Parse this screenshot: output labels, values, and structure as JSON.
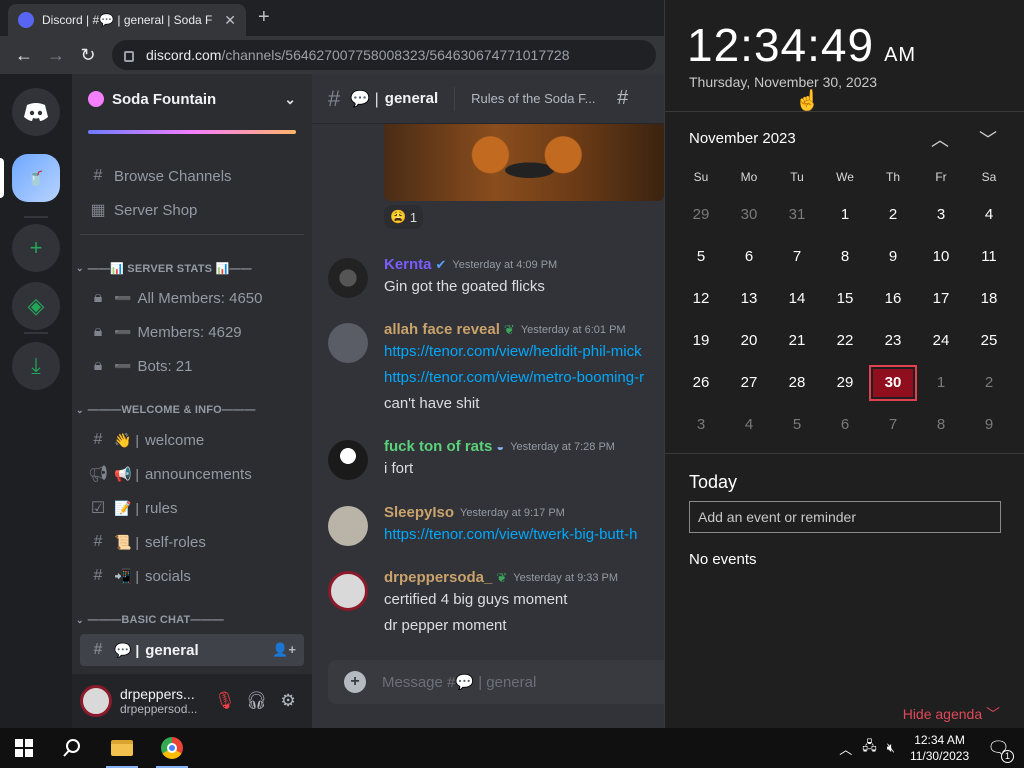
{
  "browser": {
    "tab_title": "Discord | #💬 | general | Soda F",
    "url_host": "discord.com",
    "url_path": "/channels/564627007758008323/564630674771017728"
  },
  "server": {
    "name": "Soda Fountain",
    "channels": {
      "browse": "Browse Channels",
      "shop": "Server Shop",
      "cat_stats": "——📊 SERVER STATS 📊——",
      "all_members": "All Members: 4650",
      "members": "Members: 4629",
      "bots": "Bots: 21",
      "cat_welcome": "———WELCOME & INFO———",
      "welcome": "welcome",
      "announcements": "announcements",
      "rules": "rules",
      "self_roles": "self-roles",
      "socials": "socials",
      "cat_basic": "———BASIC CHAT———",
      "general": "general"
    }
  },
  "user": {
    "display": "drpeppers...",
    "handle": "drpeppersod..."
  },
  "chat": {
    "channel": "general",
    "topic": "Rules of the Soda F...",
    "reaction_count": "1",
    "messages": [
      {
        "user": "Kernta",
        "user_color": "#7b5cff",
        "time": "Yesterday at 4:09 PM",
        "lines": [
          "Gin got the goated flicks"
        ]
      },
      {
        "user": "allah face reveal",
        "user_color": "#c9a36b",
        "time": "Yesterday at 6:01 PM",
        "lines": [
          "https://tenor.com/view/hedidit-phil-mick",
          "https://tenor.com/view/metro-booming-r",
          "can't have shit"
        ]
      },
      {
        "user": "fuck ton of rats",
        "user_color": "#5bd17a",
        "time": "Yesterday at 7:28 PM",
        "lines": [
          "i fort"
        ]
      },
      {
        "user": "SleepyIso",
        "user_color": "#c9a36b",
        "time": "Yesterday at 9:17 PM",
        "lines": [
          "https://tenor.com/view/twerk-big-butt-h"
        ]
      },
      {
        "user": "drpeppersoda_",
        "user_color": "#c9a36b",
        "time": "Yesterday at 9:33 PM",
        "lines": [
          "certified 4 big guys moment",
          "dr pepper moment"
        ]
      }
    ],
    "composer_placeholder": "Message #💬 | general"
  },
  "calendar": {
    "time": "12:34:49",
    "ampm": "AM",
    "date": "Thursday, November 30, 2023",
    "month": "November 2023",
    "dow": [
      "Su",
      "Mo",
      "Tu",
      "We",
      "Th",
      "Fr",
      "Sa"
    ],
    "days": [
      [
        "29",
        "30",
        "31",
        "1",
        "2",
        "3",
        "4"
      ],
      [
        "5",
        "6",
        "7",
        "8",
        "9",
        "10",
        "11"
      ],
      [
        "12",
        "13",
        "14",
        "15",
        "16",
        "17",
        "18"
      ],
      [
        "19",
        "20",
        "21",
        "22",
        "23",
        "24",
        "25"
      ],
      [
        "26",
        "27",
        "28",
        "29",
        "30",
        "1",
        "2"
      ],
      [
        "3",
        "4",
        "5",
        "6",
        "7",
        "8",
        "9"
      ]
    ],
    "today_label": "Today",
    "event_placeholder": "Add an event or reminder",
    "no_events": "No events",
    "hide_agenda": "Hide agenda ﹀"
  },
  "taskbar": {
    "time": "12:34 AM",
    "date": "11/30/2023",
    "notif_count": "1"
  }
}
